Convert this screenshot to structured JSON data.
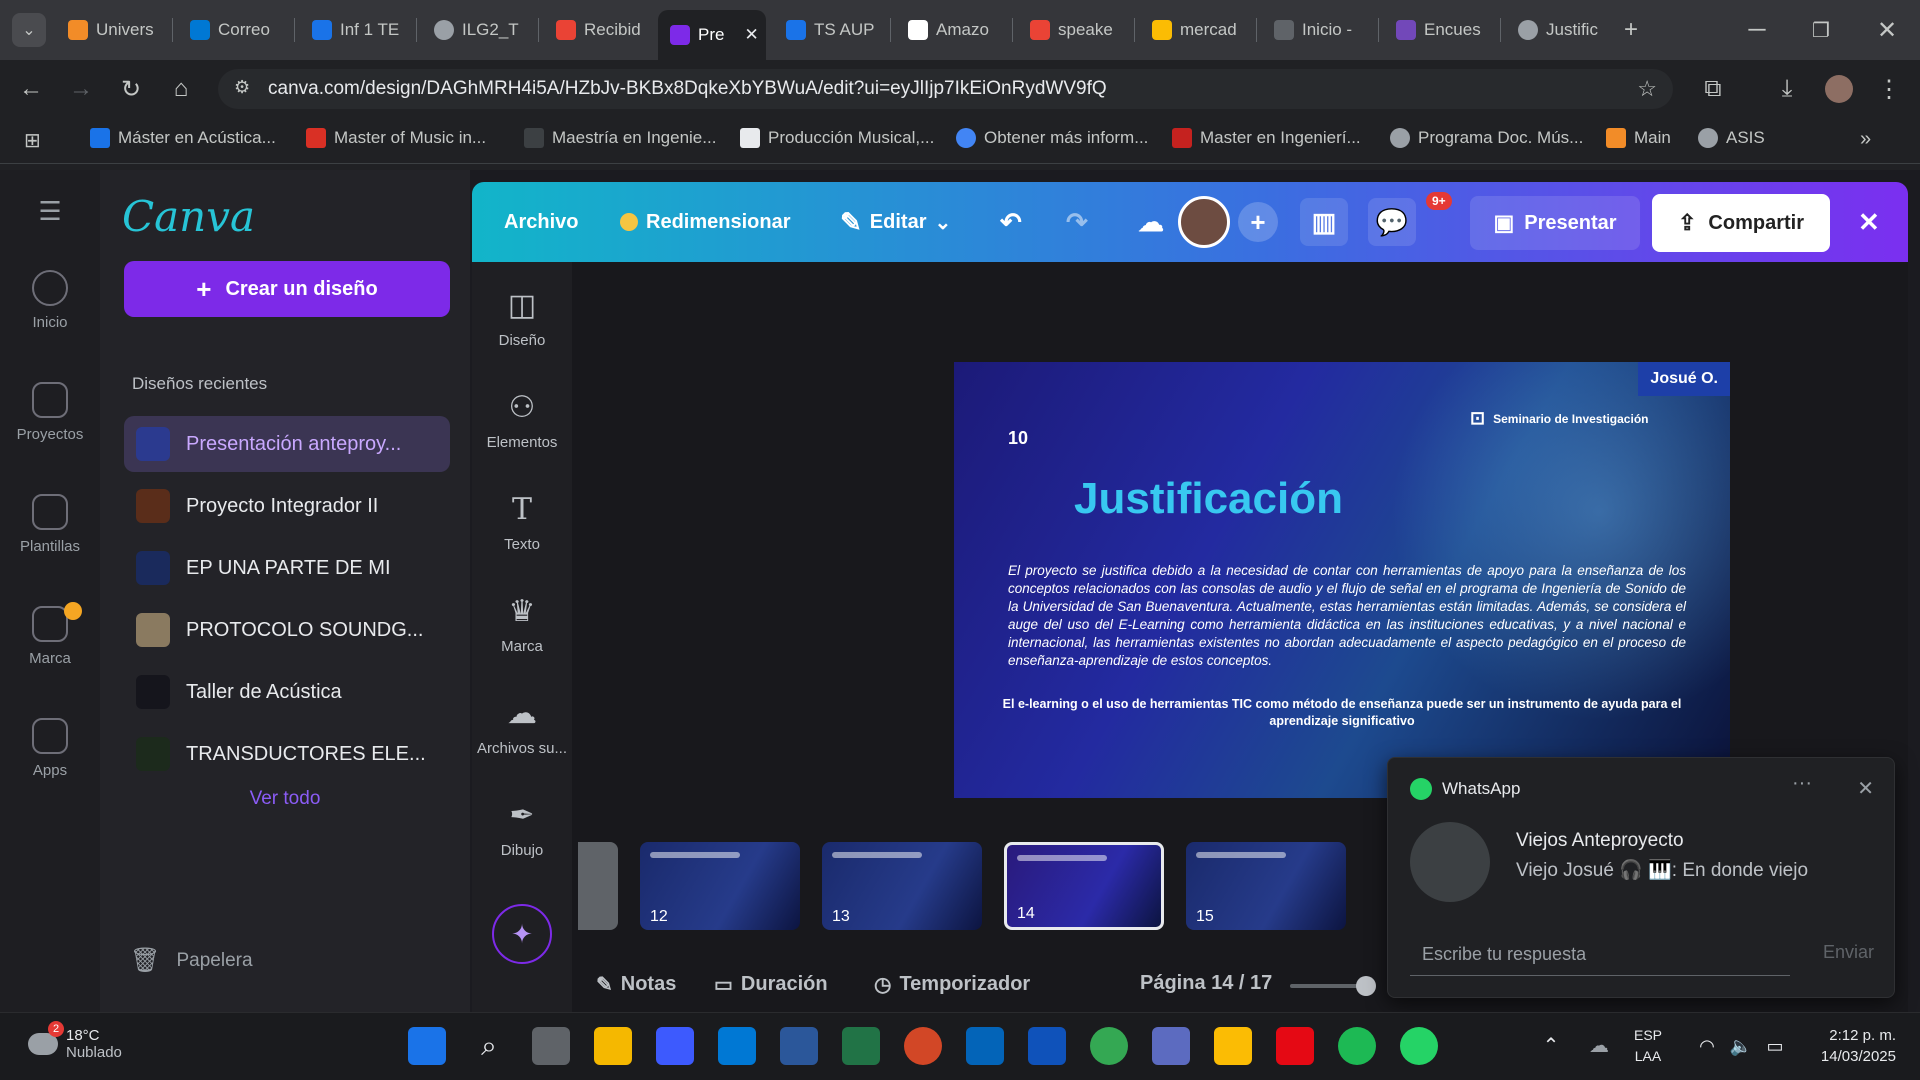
{
  "browser": {
    "tabs": [
      {
        "label": "Univers",
        "color": "#f28c28"
      },
      {
        "label": "Correo",
        "color": "#0078d4"
      },
      {
        "label": "Inf 1 TE",
        "color": "#1a73e8"
      },
      {
        "label": "ILG2_T",
        "color": "#9aa0a6"
      },
      {
        "label": "Recibid",
        "color": "#ea4335"
      },
      {
        "label": "Pre",
        "color": "#7d2ae8"
      },
      {
        "label": "TS AUP",
        "color": "#1a73e8"
      },
      {
        "label": "Amazo",
        "color": "#ffffff"
      },
      {
        "label": "speake",
        "color": "#ea4335"
      },
      {
        "label": "mercad",
        "color": "#fbbc04"
      },
      {
        "label": "Inicio -",
        "color": "#5f6368"
      },
      {
        "label": "Encues",
        "color": "#7248b9"
      },
      {
        "label": "Justific",
        "color": "#9aa0a6"
      }
    ],
    "url": "canva.com/design/DAGhMRH4i5A/HZbJv-BKBx8DqkeXbYBWuA/edit?ui=eyJlIjp7IkEiOnRydWV9fQ",
    "bookmarks": [
      {
        "label": "Máster en Acústica...",
        "color": "#1a73e8"
      },
      {
        "label": "Master of Music in...",
        "color": "#d93025"
      },
      {
        "label": "Maestría en Ingenie...",
        "color": "#3c4043"
      },
      {
        "label": "Producción Musical,...",
        "color": "#e8eaed"
      },
      {
        "label": "Obtener más inform...",
        "color": "#4285f4"
      },
      {
        "label": "Master en Ingenierí...",
        "color": "#c5221f"
      },
      {
        "label": "Programa Doc. Mús...",
        "color": "#9aa0a6"
      },
      {
        "label": "Main",
        "color": "#f28c28"
      },
      {
        "label": "ASIS",
        "color": "#9aa0a6"
      }
    ]
  },
  "canva": {
    "logo": "Canva",
    "rail": [
      "Inicio",
      "Proyectos",
      "Plantillas",
      "Marca",
      "Apps"
    ],
    "create_label": "Crear un diseño",
    "recent_header": "Diseños recientes",
    "recent": [
      {
        "label": "Presentación anteproy...",
        "color": "#2b3a8f"
      },
      {
        "label": "Proyecto Integrador II",
        "color": "#5a2d1a"
      },
      {
        "label": "EP UNA PARTE DE MI",
        "color": "#1a2a5c"
      },
      {
        "label": "PROTOCOLO SOUNDG...",
        "color": "#8a7a60"
      },
      {
        "label": "Taller de Acústica",
        "color": "#15151c"
      },
      {
        "label": "TRANSDUCTORES ELE...",
        "color": "#1c2a1c"
      }
    ],
    "see_all": "Ver todo",
    "trash": "Papelera"
  },
  "editor": {
    "menu": {
      "file": "Archivo",
      "resize": "Redimensionar",
      "edit": "Editar",
      "notif_badge": "9+",
      "present": "Presentar",
      "share": "Compartir"
    },
    "tools": [
      "Diseño",
      "Elementos",
      "Texto",
      "Marca",
      "Archivos su...",
      "Dibujo"
    ],
    "slide": {
      "number": "10",
      "author": "Josué O.",
      "seminar": "Seminario de Investigación",
      "title": "Justificación",
      "body": "El proyecto se justifica debido a la necesidad de contar con herramientas de apoyo para la enseñanza de los conceptos relacionados con las consolas de audio y el flujo de señal en el programa de Ingeniería de Sonido de la Universidad de San Buenaventura. Actualmente, estas herramientas están limitadas. Además, se considera el auge del uso del E-Learning como herramienta didáctica en las instituciones educativas, y a nivel nacional e internacional, las herramientas existentes no abordan adecuadamente el aspecto pedagógico en el proceso de enseñanza-aprendizaje de estos conceptos.",
      "footer": "El e-learning o el uso de herramientas TIC como método de enseñanza puede ser un instrumento de ayuda para el aprendizaje significativo"
    },
    "thumbnails": [
      "12",
      "13",
      "14",
      "15"
    ],
    "bottom": {
      "notes": "Notas",
      "duration": "Duración",
      "timer": "Temporizador",
      "page": "Página 14 / 17"
    }
  },
  "whatsapp": {
    "app": "WhatsApp",
    "chat": "Viejos Anteproyecto",
    "message": "Viejo Josué 🎧 🎹: En donde viejo",
    "reply_placeholder": "Escribe tu respuesta",
    "send": "Enviar"
  },
  "taskbar": {
    "weather_temp": "18°C",
    "weather_desc": "Nublado",
    "weather_badge": "2",
    "lang1": "ESP",
    "lang2": "LAA",
    "time": "2:12 p. m.",
    "date": "14/03/2025"
  }
}
